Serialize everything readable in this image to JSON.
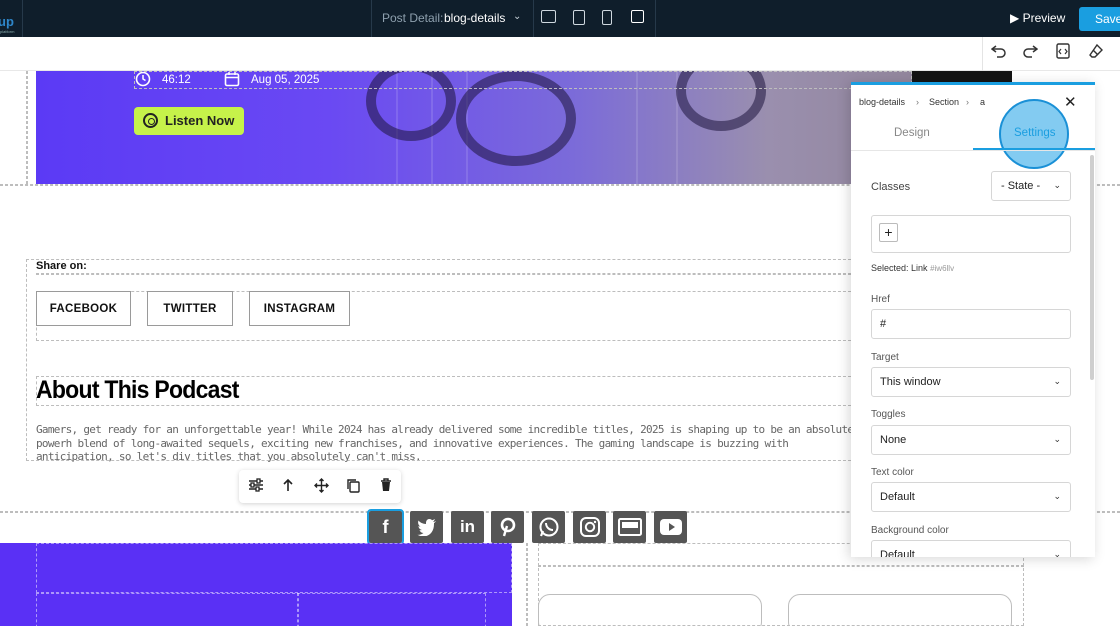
{
  "topbar": {
    "logo_text": "up",
    "logo_sub": "platform",
    "page_label": "Post Detail:",
    "page_value": "blog-details",
    "preview_label": "▶ Preview",
    "save_label": "Save"
  },
  "hero": {
    "time": "46:12",
    "date": "Aug 05, 2025",
    "listen_label": "Listen Now"
  },
  "share": {
    "label": "Share on:",
    "buttons": [
      "FACEBOOK",
      "TWITTER",
      "INSTAGRAM"
    ]
  },
  "about": {
    "title": "About This Podcast",
    "body": "Gamers, get ready for an unforgettable year! While 2024 has already delivered some incredible titles, 2025 is shaping up to be an absolute powerh blend of long-awaited sequels, exciting new franchises, and innovative experiences. The gaming landscape is buzzing with anticipation, so let's div titles that you absolutely can't miss."
  },
  "social_icons": [
    "facebook",
    "twitter",
    "linkedin",
    "pinterest",
    "whatsapp",
    "instagram",
    "email",
    "youtube"
  ],
  "panel": {
    "breadcrumb": [
      "blog-details",
      "›",
      "Section",
      "›",
      "a"
    ],
    "tabs": [
      "Design",
      "Settings"
    ],
    "active_tab": "Settings",
    "classes_label": "Classes",
    "state_value": "- State -",
    "selected_label": "Selected:",
    "selected_value": "Link",
    "selected_id": "#iw6llv",
    "href_label": "Href",
    "href_value": "#",
    "target_label": "Target",
    "target_value": "This window",
    "toggles_label": "Toggles",
    "toggles_value": "None",
    "text_color_label": "Text color",
    "text_color_value": "Default",
    "bg_color_label": "Background color",
    "bg_color_value": "Default"
  },
  "colors": {
    "topbar_bg": "#0f1e2b",
    "accent": "#1a9ee0",
    "hero_purple": "#5b3af5",
    "listen_green": "#c6f24a",
    "block_purple": "#5a30f5"
  }
}
